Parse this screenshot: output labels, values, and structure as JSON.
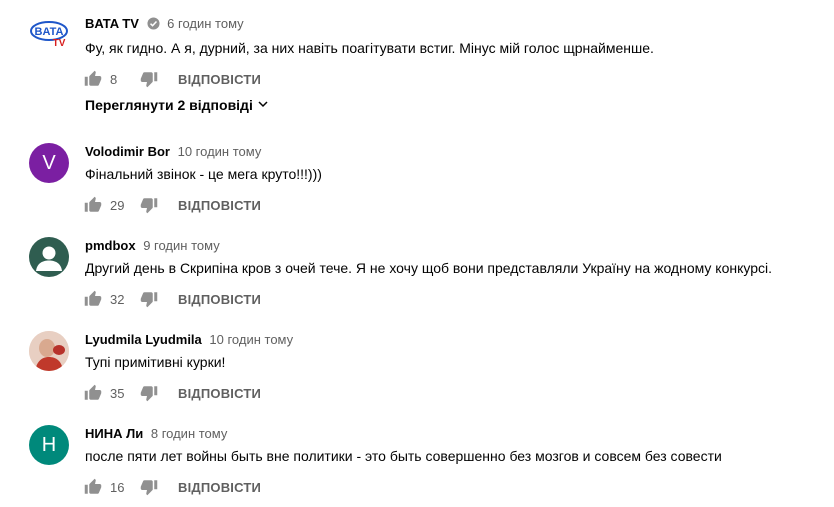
{
  "comments": [
    {
      "author": "BATA TV",
      "time": "6 годин тому",
      "text": "Фу, як гидно. А я, дурний, за них навіть поагітувати встиг. Мінус мій голос щрнайменше.",
      "likes": "8",
      "reply_label": "ВІДПОВІСТИ",
      "view_replies": "Переглянути 2 відповіді",
      "avatar": {
        "logo_text": "BATA",
        "logo_sub": "TV"
      }
    },
    {
      "author": "Volodimir Bor",
      "time": "10 годин тому",
      "text": "Фінальний звінок - це мега круто!!!)))",
      "likes": "29",
      "reply_label": "ВІДПОВІСТИ",
      "avatar": {
        "letter": "V",
        "color": "#7b1fa2"
      }
    },
    {
      "author": "pmdbox",
      "time": "9 годин тому",
      "text": "Другий день в Скрипіна кров з очей тече. Я не хочу щоб вони представляли Україну на жодному конкурсі.",
      "likes": "32",
      "reply_label": "ВІДПОВІСТИ",
      "avatar": {
        "icon": "person-silhouette-icon",
        "color": "#2f5d50"
      }
    },
    {
      "author": "Lyudmila Lyudmila",
      "time": "10 годин тому",
      "text": "Тупі примітивні курки!",
      "likes": "35",
      "reply_label": "ВІДПОВІСТИ",
      "avatar": {
        "icon": "photo-avatar",
        "color": "#c0392b"
      }
    },
    {
      "author": "НИНА Ли",
      "time": "8 годин тому",
      "text": "после пяти лет войны быть вне политики - это быть совершенно без мозгов и совсем без совести",
      "likes": "16",
      "reply_label": "ВІДПОВІСТИ",
      "avatar": {
        "letter": "Н",
        "color": "#00897b"
      }
    }
  ],
  "icons": {
    "like": "thumb-up-icon",
    "dislike": "thumb-down-icon",
    "verified": "verified-check-icon",
    "expand": "chevron-down-icon"
  },
  "colors": {
    "secondary_text": "#606060",
    "icon_gray": "#909090"
  }
}
